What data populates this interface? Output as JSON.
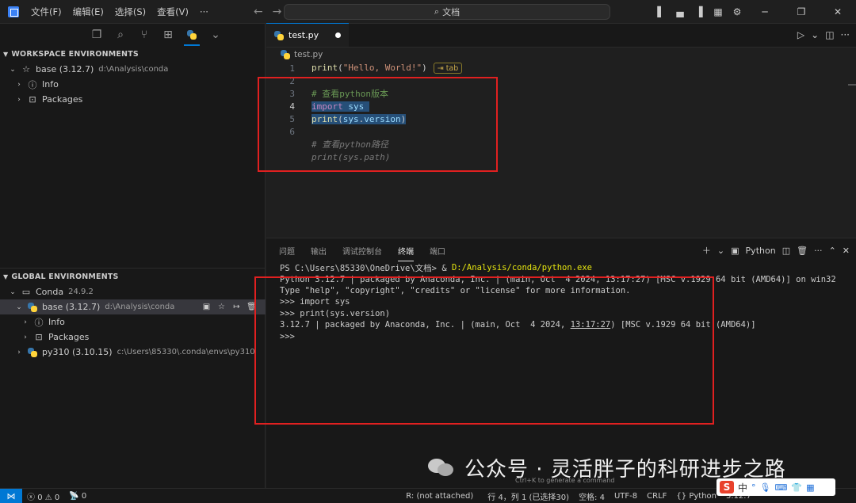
{
  "titlebar": {
    "menus": [
      "文件(F)",
      "编辑(E)",
      "选择(S)",
      "查看(V)",
      "···"
    ],
    "search_text": "文档"
  },
  "sidebar": {
    "workspace_header": "WORKSPACE ENVIRONMENTS",
    "workspace_items": [
      {
        "label": "base (3.12.7)",
        "desc": "d:\\Analysis\\conda"
      },
      {
        "label": "Info"
      },
      {
        "label": "Packages"
      }
    ],
    "global_header": "GLOBAL ENVIRONMENTS",
    "conda": {
      "label": "Conda",
      "desc": "24.9.2"
    },
    "global_items": [
      {
        "label": "base (3.12.7)",
        "desc": "d:\\Analysis\\conda"
      },
      {
        "label": "Info"
      },
      {
        "label": "Packages"
      },
      {
        "label": "py310 (3.10.15)",
        "desc": "c:\\Users\\85330\\.conda\\envs\\py310"
      }
    ]
  },
  "editor": {
    "tab_label": "test.py",
    "breadcrumb": "test.py",
    "lines": {
      "l1": {
        "num": "1",
        "fn": "print",
        "open": "(",
        "str": "\"Hello, World!\"",
        "close": ")",
        "hint": "⇥ tab"
      },
      "l2": {
        "num": "2"
      },
      "l3": {
        "num": "3",
        "comment": "# 查看python版本"
      },
      "l4": {
        "num": "4",
        "kw": "import",
        "var": "sys"
      },
      "l5": {
        "num": "5",
        "fn": "print",
        "open": "(",
        "var": "sys",
        "dot": ".",
        "attr": "version",
        "close": ")"
      },
      "l6": {
        "num": "6"
      },
      "ghost1": "# 查看python路径",
      "ghost2": "print(sys.path)"
    }
  },
  "panel": {
    "tabs": [
      "问题",
      "输出",
      "调试控制台",
      "终端",
      "端口"
    ],
    "active_tab": "终端",
    "terminal_profile": "Python",
    "terminal": {
      "prompt_prefix": "PS C:\\Users\\85330\\OneDrive\\文档> & ",
      "prompt_cmd": "D:/Analysis/conda/python.exe",
      "l2": "Python 3.12.7 | packaged by Anaconda, Inc. | (main, Oct  4 2024, 13:17:27) [MSC v.1929 64 bit (AMD64)] on win32",
      "l3": "Type \"help\", \"copyright\", \"credits\" or \"license\" for more information.",
      "l4": ">>> import sys",
      "l5": ">>> print(sys.version)",
      "l6a": "3.12.7 | packaged by Anaconda, Inc. | (main, Oct  4 2024, ",
      "l6b": "13:17:27",
      "l6c": ") [MSC v.1929 64 bit (AMD64)]",
      "l7": ">>>"
    }
  },
  "statusbar": {
    "errors": "0",
    "warnings": "0",
    "ports": "0",
    "r_status": "R: (not attached)",
    "cursor": "行 4，列 1 (已选择30)",
    "spaces": "空格: 4",
    "encoding": "UTF-8",
    "eol": "CRLF",
    "language": "Python",
    "interpreter": "3.12.7"
  },
  "watermark": {
    "text": "公众号 · 灵活胖子的科研进步之路",
    "ctrl_hint": "Ctrl+K to generate a command"
  },
  "ime": {
    "s": "S",
    "mode": "中"
  },
  "colors": {
    "accent": "#0078d4",
    "annotation_red": "#e02020",
    "selection": "#264f78"
  }
}
